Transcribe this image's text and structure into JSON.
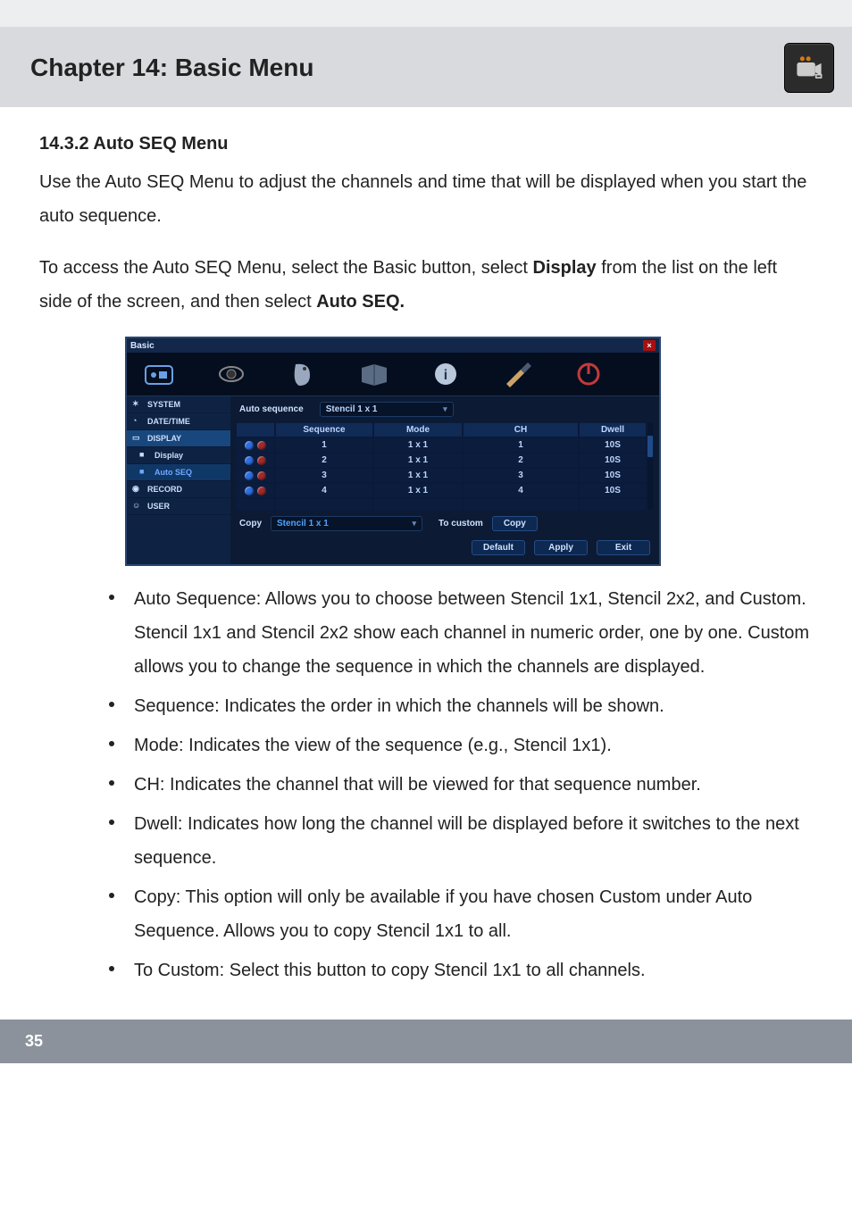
{
  "header": {
    "chapter_title": "Chapter 14: Basic Menu"
  },
  "section": {
    "heading": "14.3.2 Auto SEQ Menu",
    "para1": "Use the Auto SEQ Menu to adjust the channels and time that will be displayed when you start the auto sequence.",
    "para2_a": "To access the Auto SEQ Menu, select the Basic button, select ",
    "para2_b": "Display",
    "para2_c": " from the list on the left side of the screen, and then select ",
    "para2_d": "Auto SEQ."
  },
  "ui": {
    "titlebar": "Basic",
    "sidebar": {
      "system": "SYSTEM",
      "datetime": "DATE/TIME",
      "display": "DISPLAY",
      "display_sub": "Display",
      "autoseq_sub": "Auto SEQ",
      "record": "RECORD",
      "user": "USER"
    },
    "main": {
      "autoseq_label": "Auto sequence",
      "autoseq_value": "Stencil 1 x 1",
      "columns": {
        "seq": "Sequence",
        "mode": "Mode",
        "ch": "CH",
        "dwell": "Dwell"
      },
      "rows": [
        {
          "seq": "1",
          "mode": "1 x 1",
          "ch": "1",
          "dwell": "10S"
        },
        {
          "seq": "2",
          "mode": "1 x 1",
          "ch": "2",
          "dwell": "10S"
        },
        {
          "seq": "3",
          "mode": "1 x 1",
          "ch": "3",
          "dwell": "10S"
        },
        {
          "seq": "4",
          "mode": "1 x 1",
          "ch": "4",
          "dwell": "10S"
        }
      ],
      "copy_label": "Copy",
      "copy_value": "Stencil 1 x 1",
      "tocustom_label": "To custom",
      "copy_btn": "Copy",
      "default_btn": "Default",
      "apply_btn": "Apply",
      "exit_btn": "Exit"
    }
  },
  "bullets": {
    "b1": {
      "t": "Auto Sequence:",
      "rest_a": " Allows you to choose between Stencil 1x1, Stencil 2x2, and Custom. ",
      "s1": "Stencil 1x1",
      "mid": " and ",
      "s2": "Stencil 2x2",
      "rest_b": " show each channel in numeric order, one by one. ",
      "s3": "Custom",
      "rest_c": " allows you to change the sequence in which the channels are displayed."
    },
    "b2": {
      "t": "Sequence:",
      "rest": " Indicates the order in which the channels will be shown."
    },
    "b3": {
      "t": "Mode:",
      "rest": " Indicates the view of the sequence (e.g., Stencil 1x1)."
    },
    "b4": {
      "t": "CH:",
      "rest": " Indicates the channel that will be viewed for that sequence number."
    },
    "b5": {
      "t": "Dwell:",
      "rest": " Indicates how long the channel will be displayed before it switches to the next sequence."
    },
    "b6": {
      "t": "Copy:",
      "rest": " This option will only be available if you have chosen Custom under Auto Sequence. Allows you to copy Stencil 1x1 to all."
    },
    "b7": {
      "t": "To Custom:",
      "rest": " Select this button to copy Stencil 1x1 to all channels."
    }
  },
  "page_number": "35"
}
